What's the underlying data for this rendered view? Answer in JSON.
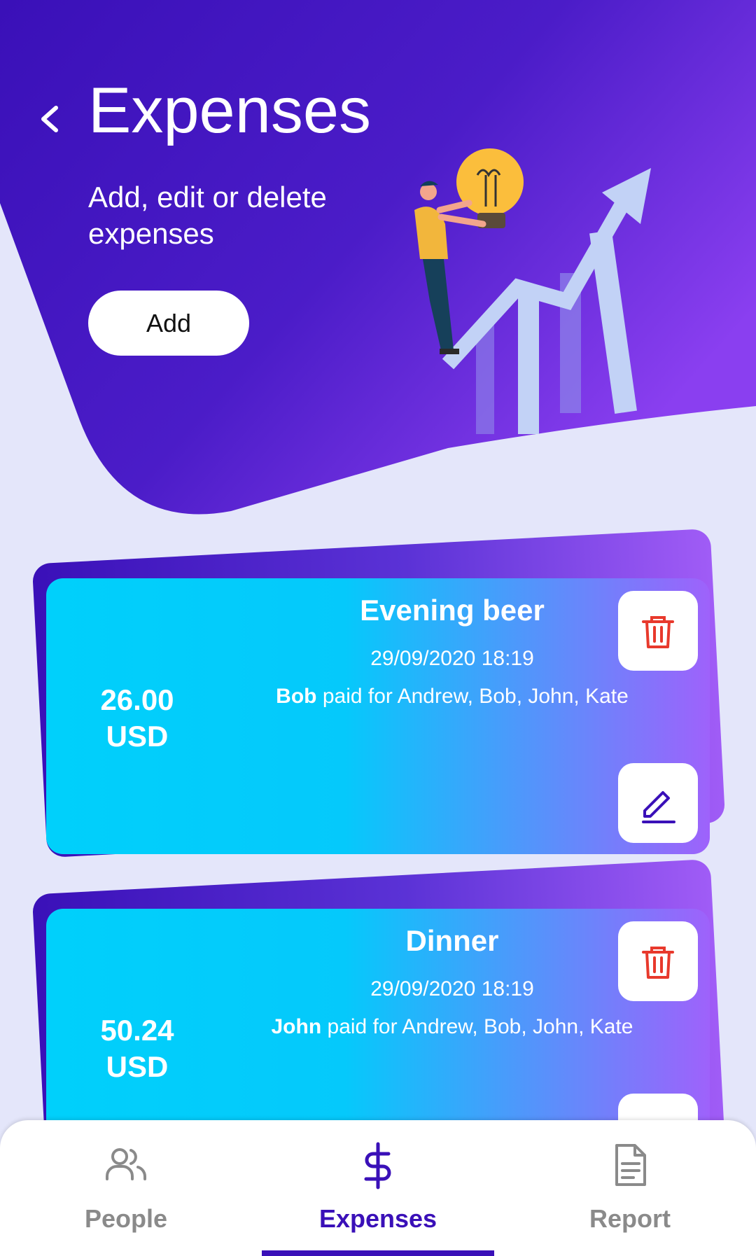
{
  "header": {
    "title": "Expenses",
    "subtitle": "Add, edit or delete expenses",
    "add_label": "Add"
  },
  "expenses": [
    {
      "title": "Evening beer",
      "date": "29/09/2020 18:19",
      "payer": "Bob",
      "paid_for_text": " paid for Andrew, Bob, John, Kate",
      "amount": "26.00",
      "currency": "USD"
    },
    {
      "title": "Dinner",
      "date": "29/09/2020 18:19",
      "payer": "John",
      "paid_for_text": " paid for Andrew, Bob, John, Kate",
      "amount": "50.24",
      "currency": "USD"
    }
  ],
  "nav": {
    "items": [
      {
        "label": "People",
        "icon": "people-icon",
        "active": false
      },
      {
        "label": "Expenses",
        "icon": "dollar-icon",
        "active": true
      },
      {
        "label": "Report",
        "icon": "document-icon",
        "active": false
      }
    ]
  },
  "colors": {
    "primary": "#3a10b8",
    "cyan": "#00d0fb",
    "purple": "#9e62fb",
    "background": "#e4e6fa",
    "delete_red": "#e8392c"
  }
}
